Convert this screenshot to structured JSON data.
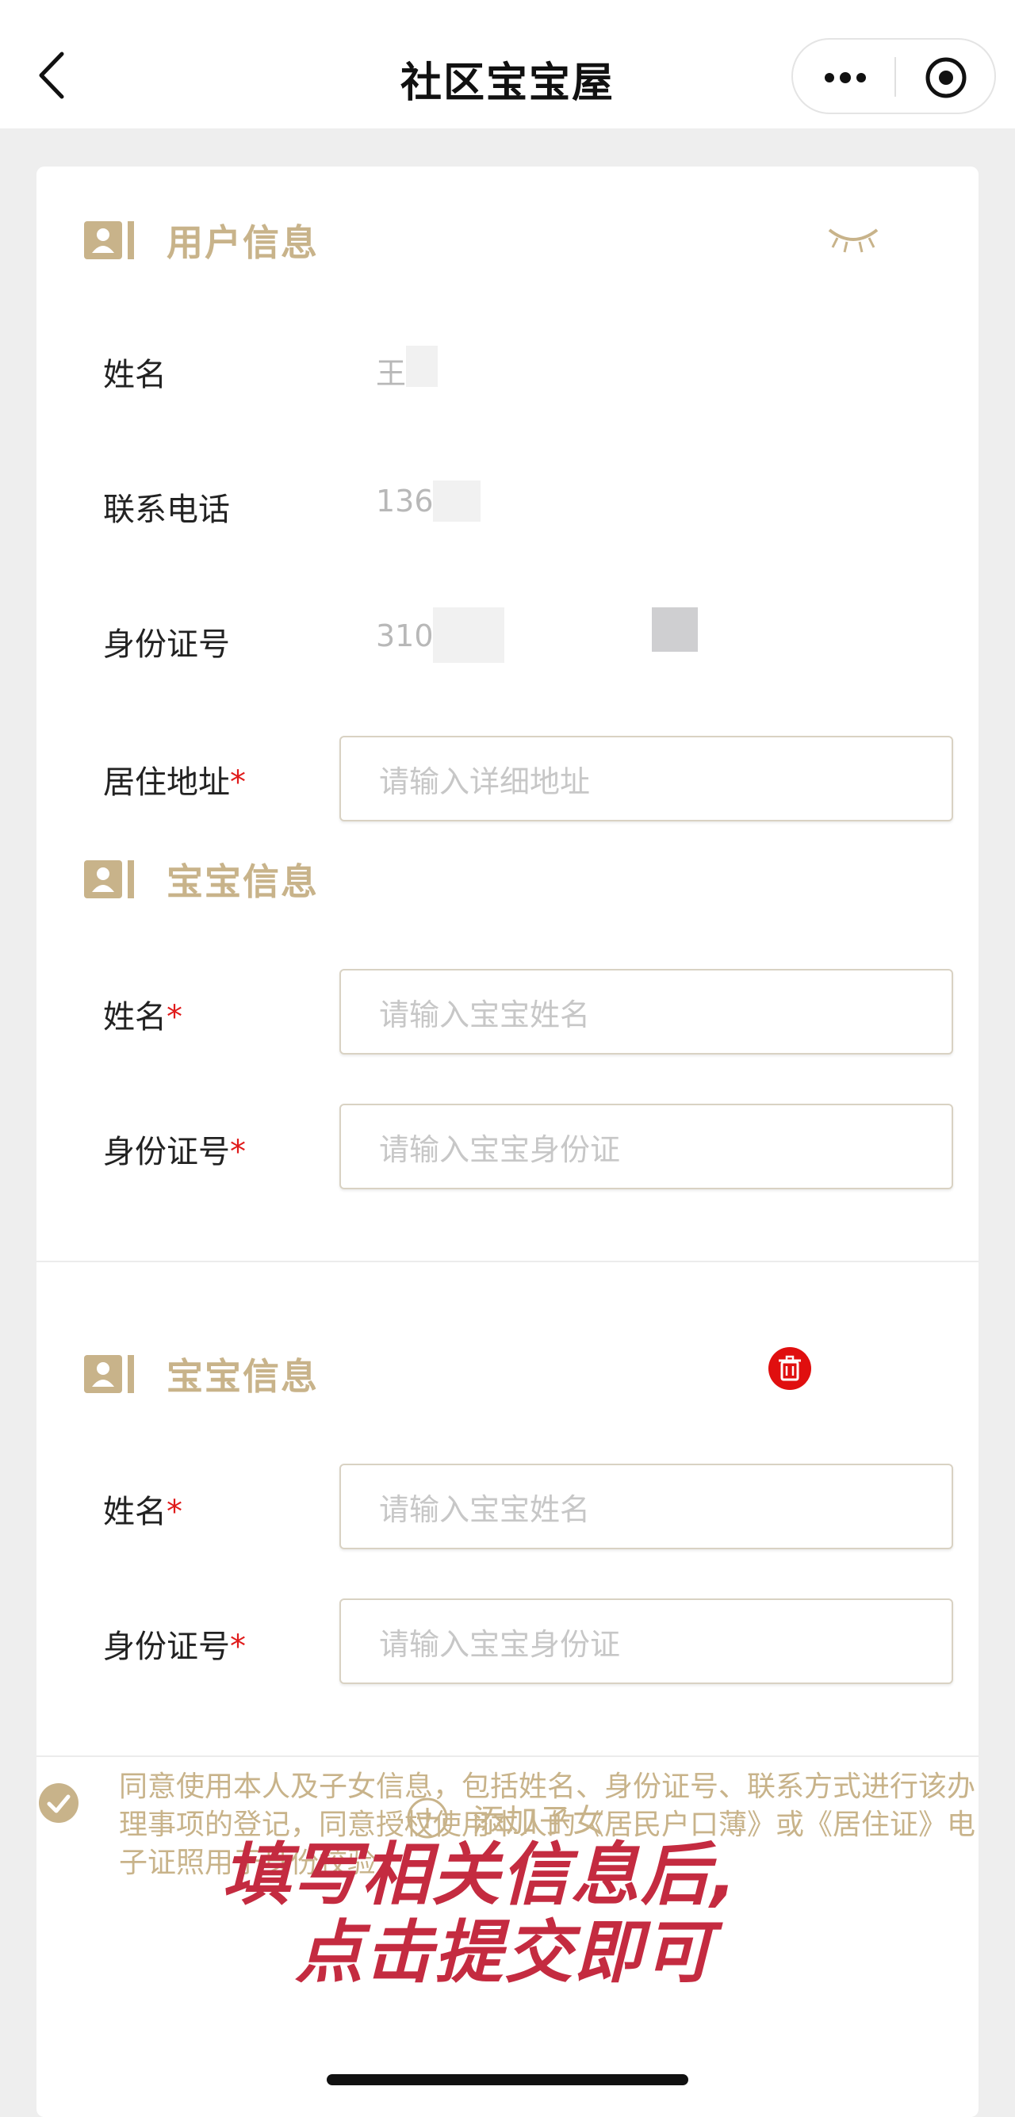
{
  "nav": {
    "title": "社区宝宝屋",
    "back_icon": "chevron-left-icon",
    "more_icon": "more-dots-icon",
    "target_icon": "target-icon"
  },
  "user_info": {
    "title": "用户信息",
    "fields": {
      "name": {
        "label": "姓名",
        "value": "王"
      },
      "phone": {
        "label": "联系电话",
        "value": "136"
      },
      "id_number": {
        "label": "身份证号",
        "value": "310"
      },
      "address": {
        "label": "居住地址",
        "required": "*",
        "placeholder": "请输入详细地址"
      }
    }
  },
  "baby_sections": [
    {
      "title": "宝宝信息",
      "name": {
        "label": "姓名",
        "required": "*",
        "placeholder": "请输入宝宝姓名"
      },
      "id_number": {
        "label": "身份证号",
        "required": "*",
        "placeholder": "请输入宝宝身份证"
      }
    },
    {
      "title": "宝宝信息",
      "name": {
        "label": "姓名",
        "required": "*",
        "placeholder": "请输入宝宝姓名"
      },
      "id_number": {
        "label": "身份证号",
        "required": "*",
        "placeholder": "请输入宝宝身份证"
      }
    }
  ],
  "add_child": {
    "label": "添加子女"
  },
  "agreement": {
    "text": "同意使用本人及子女信息，包括姓名、身份证号、联系方式进行该办理事项的登记，同意授权使用本人的《居民户口薄》或《居住证》电子证照用于身份校验"
  },
  "overlay_caption": {
    "line1": "填写相关信息后,",
    "line2": "点击提交即可"
  },
  "colors": {
    "accent": "#c8b38a",
    "required": "#e01b1b",
    "delete": "#e00f0f",
    "caption": "#c42b40"
  }
}
